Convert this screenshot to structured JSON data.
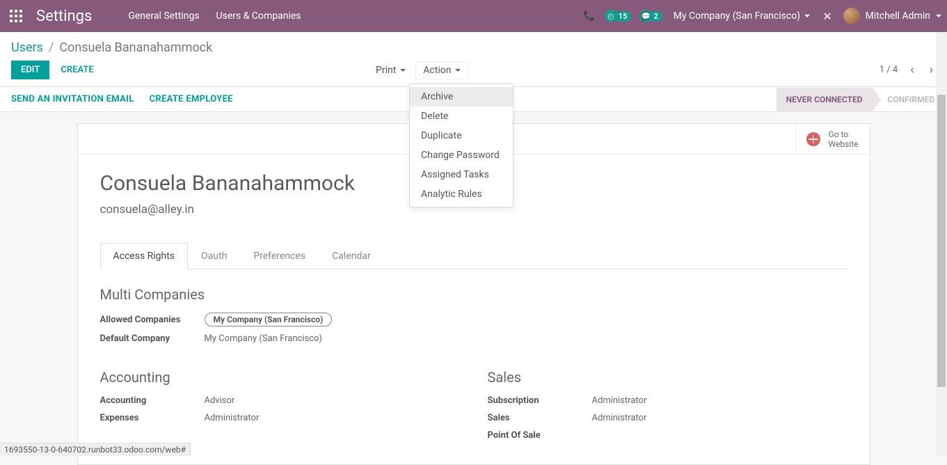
{
  "topbar": {
    "app_title": "Settings",
    "nav": [
      "General Settings",
      "Users & Companies"
    ],
    "activities_count": "15",
    "messages_count": "2",
    "company": "My Company (San Francisco)",
    "user": "Mitchell Admin"
  },
  "breadcrumb": {
    "root": "Users",
    "current": "Consuela Bananahammock"
  },
  "buttons": {
    "edit": "EDIT",
    "create": "CREATE",
    "print": "Print",
    "action": "Action"
  },
  "pager": {
    "text": "1 / 4"
  },
  "action_menu": [
    "Archive",
    "Delete",
    "Duplicate",
    "Change Password",
    "Assigned Tasks",
    "Analytic Rules"
  ],
  "action_menu_hover_index": 0,
  "actions_bar": {
    "send_invite": "SEND AN INVITATION EMAIL",
    "create_employee": "CREATE EMPLOYEE"
  },
  "status": {
    "active": "NEVER CONNECTED",
    "inactive": "CONFIRMED"
  },
  "website_btn": {
    "line1": "Go to",
    "line2": "Website"
  },
  "record": {
    "name": "Consuela Bananahammock",
    "email": "consuela@alley.in"
  },
  "tabs": [
    "Access Rights",
    "Oauth",
    "Preferences",
    "Calendar"
  ],
  "active_tab_index": 0,
  "multi_companies": {
    "title": "Multi Companies",
    "allowed_label": "Allowed Companies",
    "allowed_value": "My Company (San Francisco)",
    "default_label": "Default Company",
    "default_value": "My Company (San Francisco)"
  },
  "accounting": {
    "title": "Accounting",
    "rows": [
      {
        "label": "Accounting",
        "value": "Advisor"
      },
      {
        "label": "Expenses",
        "value": "Administrator"
      }
    ]
  },
  "sales": {
    "title": "Sales",
    "rows": [
      {
        "label": "Subscription",
        "value": "Administrator"
      },
      {
        "label": "Sales",
        "value": "Administrator"
      },
      {
        "label": "Point Of Sale",
        "value": ""
      }
    ]
  },
  "status_url": "1693550-13-0-640702.runbot33.odoo.com/web#"
}
